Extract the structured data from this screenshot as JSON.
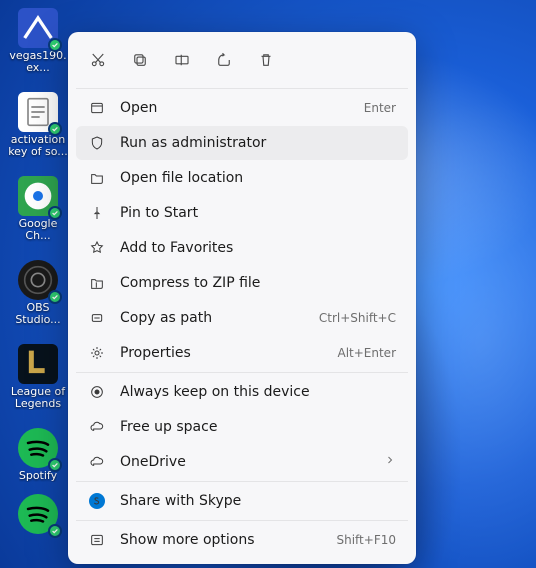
{
  "desktop_icons": [
    {
      "label": "vegas190.ex...",
      "bg": "#2c52c7",
      "name": "vegas"
    },
    {
      "label": "activation key of so...",
      "bg": "#ffffff",
      "name": "textfile"
    },
    {
      "label": "Google Ch...",
      "bg": "#2ea44f",
      "name": "chrome"
    },
    {
      "label": "OBS Studio...",
      "bg": "#1a1a1a",
      "name": "obs"
    },
    {
      "label": "League of Legends",
      "bg": "#caa64a",
      "name": "league"
    },
    {
      "label": "Spotify",
      "bg": "#1db954",
      "name": "spotify"
    },
    {
      "label": "",
      "bg": "#1db954",
      "name": "spotify2"
    }
  ],
  "toolbar": [
    "cut",
    "copy",
    "rename",
    "share",
    "delete"
  ],
  "menu": {
    "group1": [
      {
        "label": "Open",
        "acc": "Enter",
        "icon": "open"
      },
      {
        "label": "Run as administrator",
        "acc": "",
        "icon": "admin",
        "hover": true
      },
      {
        "label": "Open file location",
        "acc": "",
        "icon": "folder"
      },
      {
        "label": "Pin to Start",
        "acc": "",
        "icon": "pin"
      },
      {
        "label": "Add to Favorites",
        "acc": "",
        "icon": "star"
      },
      {
        "label": "Compress to ZIP file",
        "acc": "",
        "icon": "zip"
      },
      {
        "label": "Copy as path",
        "acc": "Ctrl+Shift+C",
        "icon": "path"
      },
      {
        "label": "Properties",
        "acc": "Alt+Enter",
        "icon": "props"
      }
    ],
    "group2": [
      {
        "label": "Always keep on this device",
        "icon": "keep"
      },
      {
        "label": "Free up space",
        "icon": "free"
      },
      {
        "label": "OneDrive",
        "icon": "onedrive",
        "chevron": true
      }
    ],
    "group3": [
      {
        "label": "Share with Skype",
        "icon": "skype"
      }
    ],
    "group4": [
      {
        "label": "Show more options",
        "acc": "Shift+F10",
        "icon": "more"
      }
    ]
  }
}
